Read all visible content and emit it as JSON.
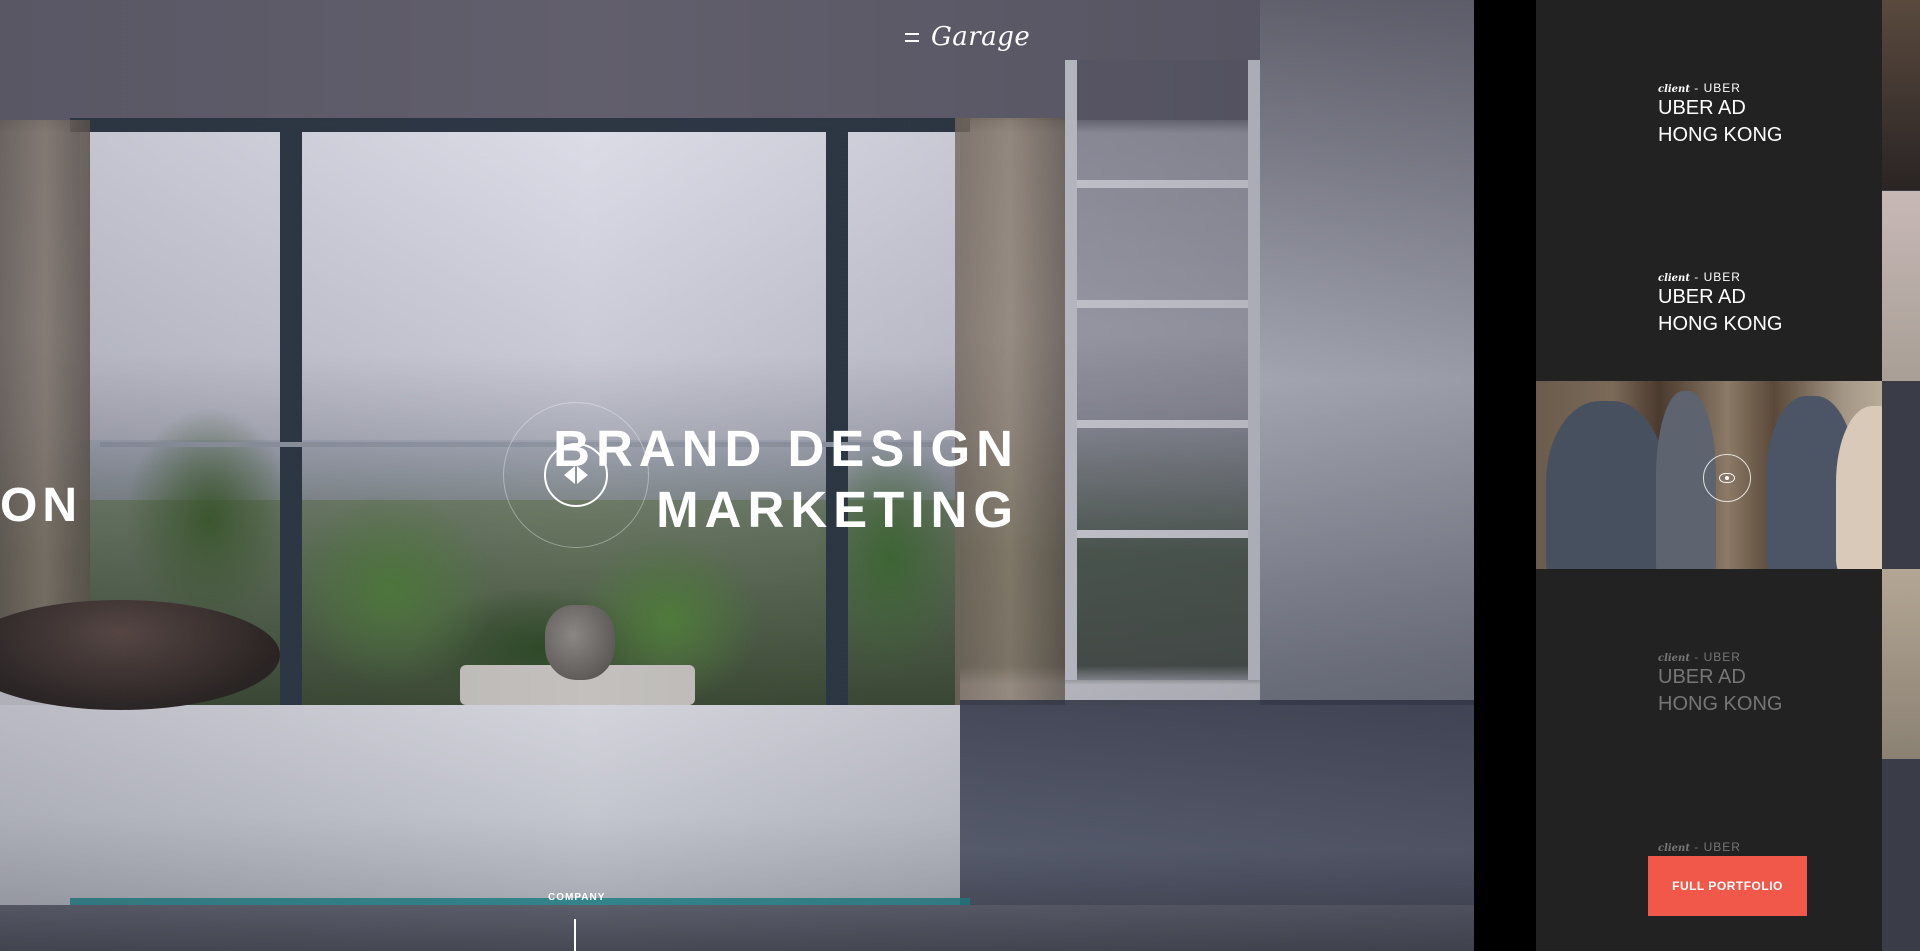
{
  "header": {
    "menu_icon": "hamburger-icon",
    "logo": "Garage"
  },
  "hero": {
    "headline_left": "ON",
    "headline_right": [
      "BRAND DESIGN",
      "MARKETING"
    ],
    "play_icon": "slide-arrows-icon",
    "section_label": "COMPANY"
  },
  "portfolio": {
    "items": [
      {
        "client_prefix": "client",
        "client_name": " - UBER",
        "title": [
          "UBER AD",
          "HONG KONG"
        ]
      },
      {
        "client_prefix": "client",
        "client_name": " - UBER",
        "title": [
          "UBER AD",
          "HONG KONG"
        ]
      },
      {
        "client_prefix": "client",
        "client_name": " - UBER",
        "title": [
          "UBER AD",
          "HONG KONG"
        ]
      },
      {
        "client_prefix": "client",
        "client_name": " - UBER",
        "title": []
      }
    ],
    "view_icon": "eye-icon",
    "button_label": "FULL PORTFOLIO",
    "accent_color": "#f2584a"
  }
}
